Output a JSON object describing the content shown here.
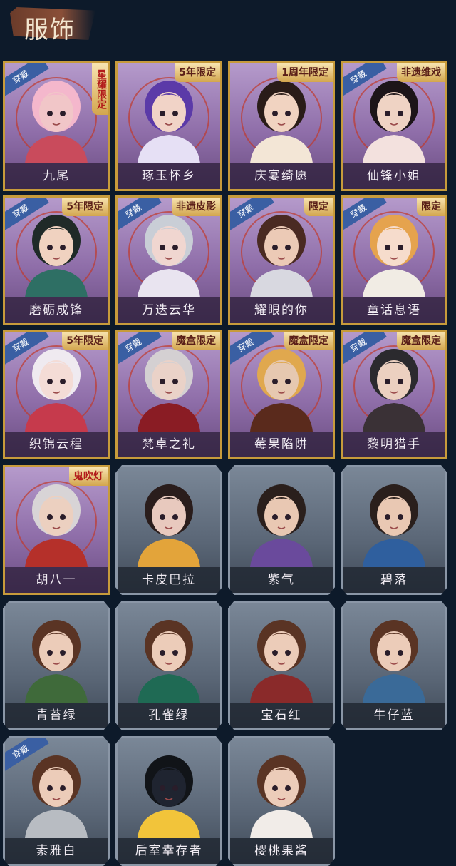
{
  "header": {
    "title": "服饰"
  },
  "badges": {
    "wear": "穿戴"
  },
  "cards": [
    {
      "name": "九尾",
      "tag": "星耀限定",
      "wearing": true,
      "style": "purple",
      "skin": "#f1c6c8",
      "hair": "#f4b7cc",
      "cloth": "#c94b5c",
      "vertical": true
    },
    {
      "name": "琢玉怀乡",
      "tag": "5年限定",
      "wearing": false,
      "style": "purple",
      "skin": "#f1d3c7",
      "hair": "#5b3aa8",
      "cloth": "#e6e0f5"
    },
    {
      "name": "庆宴绮愿",
      "tag": "1周年限定",
      "wearing": false,
      "style": "purple",
      "skin": "#f1d3c1",
      "hair": "#2a1c18",
      "cloth": "#f3e6d6"
    },
    {
      "name": "仙锋小姐",
      "tag": "非遗维戏",
      "wearing": true,
      "style": "purple",
      "skin": "#efd3c4",
      "hair": "#1c1418",
      "cloth": "#f3e1de"
    },
    {
      "name": "磨砺成锋",
      "tag": "5年限定",
      "wearing": true,
      "style": "purple",
      "skin": "#f0d2c0",
      "hair": "#1f2a28",
      "cloth": "#2e6f64"
    },
    {
      "name": "万迭云华",
      "tag": "非遗皮影",
      "wearing": true,
      "style": "purple",
      "skin": "#f0d6d0",
      "hair": "#c9ced6",
      "cloth": "#e9e4f0"
    },
    {
      "name": "耀眼的你",
      "tag": "限定",
      "wearing": true,
      "style": "purple",
      "skin": "#eccab6",
      "hair": "#4a2a22",
      "cloth": "#d8d8e0"
    },
    {
      "name": "童话息语",
      "tag": "限定",
      "wearing": true,
      "style": "purple",
      "skin": "#f6dccc",
      "hair": "#e5a34e",
      "cloth": "#f1ece4"
    },
    {
      "name": "织锦云程",
      "tag": "5年限定",
      "wearing": true,
      "style": "purple",
      "skin": "#f4dcd6",
      "hair": "#efeaf0",
      "cloth": "#c63a4c"
    },
    {
      "name": "梵卓之礼",
      "tag": "魔盒限定",
      "wearing": true,
      "style": "purple",
      "skin": "#ead2c8",
      "hair": "#d4d0d2",
      "cloth": "#8a1c24"
    },
    {
      "name": "莓果陷阱",
      "tag": "魔盒限定",
      "wearing": true,
      "style": "purple",
      "skin": "#e6c8b0",
      "hair": "#e0a84e",
      "cloth": "#5a2a1c"
    },
    {
      "name": "黎明猎手",
      "tag": "魔盒限定",
      "wearing": true,
      "style": "purple",
      "skin": "#ecd0c0",
      "hair": "#2b2a2e",
      "cloth": "#3a3136"
    },
    {
      "name": "胡八一",
      "tag": "鬼吹灯",
      "wearing": false,
      "style": "purple",
      "skin": "#ecd0c0",
      "hair": "#d8d4d6",
      "cloth": "#b5302a"
    },
    {
      "name": "卡皮巴拉",
      "tag": "",
      "wearing": false,
      "style": "gray",
      "skin": "#e8c9be",
      "hair": "#2a1d1c",
      "cloth": "#e3a43a"
    },
    {
      "name": "紫气",
      "tag": "",
      "wearing": false,
      "style": "gray",
      "skin": "#e9c8b3",
      "hair": "#2a1f1c",
      "cloth": "#6a4a9c"
    },
    {
      "name": "碧落",
      "tag": "",
      "wearing": false,
      "style": "gray",
      "skin": "#e9c8b3",
      "hair": "#2a1f1c",
      "cloth": "#2f5f9e"
    },
    {
      "name": "青苔绿",
      "tag": "",
      "wearing": false,
      "style": "gray",
      "skin": "#ecccb9",
      "hair": "#5a3424",
      "cloth": "#3f6a3a"
    },
    {
      "name": "孔雀绿",
      "tag": "",
      "wearing": false,
      "style": "gray",
      "skin": "#ecccb9",
      "hair": "#5a3424",
      "cloth": "#1f6a54"
    },
    {
      "name": "宝石红",
      "tag": "",
      "wearing": false,
      "style": "gray",
      "skin": "#ecccb9",
      "hair": "#5a3424",
      "cloth": "#8a2a2a"
    },
    {
      "name": "牛仔蓝",
      "tag": "",
      "wearing": false,
      "style": "gray",
      "skin": "#ecccb9",
      "hair": "#5a3424",
      "cloth": "#3a6a98"
    },
    {
      "name": "素雅白",
      "tag": "",
      "wearing": true,
      "style": "gray",
      "skin": "#ecccb9",
      "hair": "#5a3424",
      "cloth": "#b8bcc2"
    },
    {
      "name": "后室幸存者",
      "tag": "",
      "wearing": false,
      "style": "gray",
      "skin": "#1f2430",
      "hair": "#111418",
      "cloth": "#f2c43a"
    },
    {
      "name": "樱桃果酱",
      "tag": "",
      "wearing": false,
      "style": "gray",
      "skin": "#ecccb9",
      "hair": "#5a3424",
      "cloth": "#f1ece8"
    }
  ]
}
